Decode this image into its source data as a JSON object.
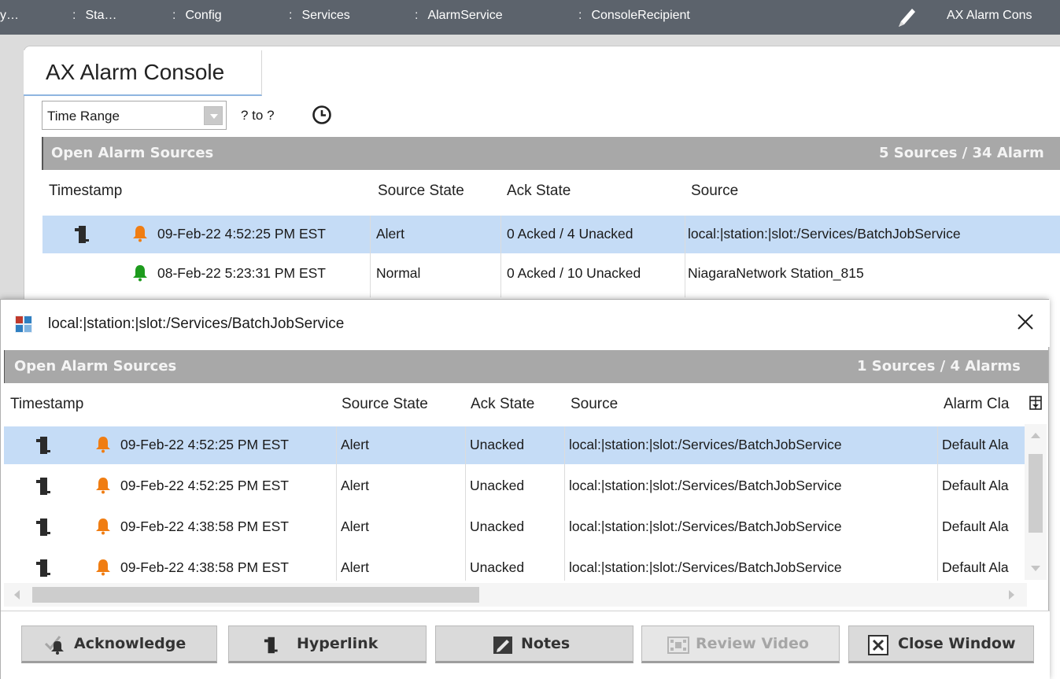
{
  "breadcrumbs": [
    "y…",
    "Sta…",
    "Config",
    "Services",
    "AlarmService",
    "ConsoleRecipient"
  ],
  "breadcrumb_separator": ":",
  "app_title": "AX Alarm Cons",
  "tab_label": "AX Alarm Console",
  "time_range": {
    "value": "Time Range",
    "range_text": "? to ?"
  },
  "open_alarm_sources": {
    "title": "Open Alarm Sources",
    "summary": "5 Sources / 34 Alarm"
  },
  "columns": {
    "timestamp": "Timestamp",
    "source_state": "Source State",
    "ack_state": "Ack State",
    "source": "Source"
  },
  "bg_rows": [
    {
      "timestamp": "09-Feb-22 4:52:25 PM EST",
      "source_state": "Alert",
      "ack_state": "0 Acked / 4 Unacked",
      "source": "local:|station:|slot:/Services/BatchJobService",
      "bell": "orange-bell-icon",
      "has_hyperlink": true,
      "selected": true
    },
    {
      "timestamp": "08-Feb-22 5:23:31 PM EST",
      "source_state": "Normal",
      "ack_state": "0 Acked / 10 Unacked",
      "source": "NiagaraNetwork Station_815",
      "bell": "green-bell-icon",
      "has_hyperlink": false,
      "selected": false
    }
  ],
  "popup": {
    "title": "local:|station:|slot:/Services/BatchJobService",
    "header": {
      "title": "Open Alarm Sources",
      "summary": "1 Sources / 4 Alarms"
    },
    "columns": {
      "timestamp": "Timestamp",
      "source_state": "Source State",
      "ack_state": "Ack State",
      "source": "Source",
      "alarm_class": "Alarm Cla"
    },
    "rows": [
      {
        "timestamp": "09-Feb-22 4:52:25 PM EST",
        "source_state": "Alert",
        "ack_state": "Unacked",
        "source": "local:|station:|slot:/Services/BatchJobService",
        "alarm_class": "Default Ala",
        "selected": true
      },
      {
        "timestamp": "09-Feb-22 4:52:25 PM EST",
        "source_state": "Alert",
        "ack_state": "Unacked",
        "source": "local:|station:|slot:/Services/BatchJobService",
        "alarm_class": "Default Ala",
        "selected": false
      },
      {
        "timestamp": "09-Feb-22 4:38:58 PM EST",
        "source_state": "Alert",
        "ack_state": "Unacked",
        "source": "local:|station:|slot:/Services/BatchJobService",
        "alarm_class": "Default Ala",
        "selected": false
      },
      {
        "timestamp": "09-Feb-22 4:38:58 PM EST",
        "source_state": "Alert",
        "ack_state": "Unacked",
        "source": "local:|station:|slot:/Services/BatchJobService",
        "alarm_class": "Default Ala",
        "selected": false
      }
    ],
    "buttons": {
      "acknowledge": "Acknowledge",
      "hyperlink": "Hyperlink",
      "notes": "Notes",
      "review_video": "Review Video",
      "close_window": "Close Window"
    }
  },
  "colors": {
    "topbar": "#5c636c",
    "selected_row": "#c5dcf6",
    "header_bar": "#a8a8a8",
    "alert_bell": "#f07d12",
    "normal_bell": "#1d9b1d"
  }
}
